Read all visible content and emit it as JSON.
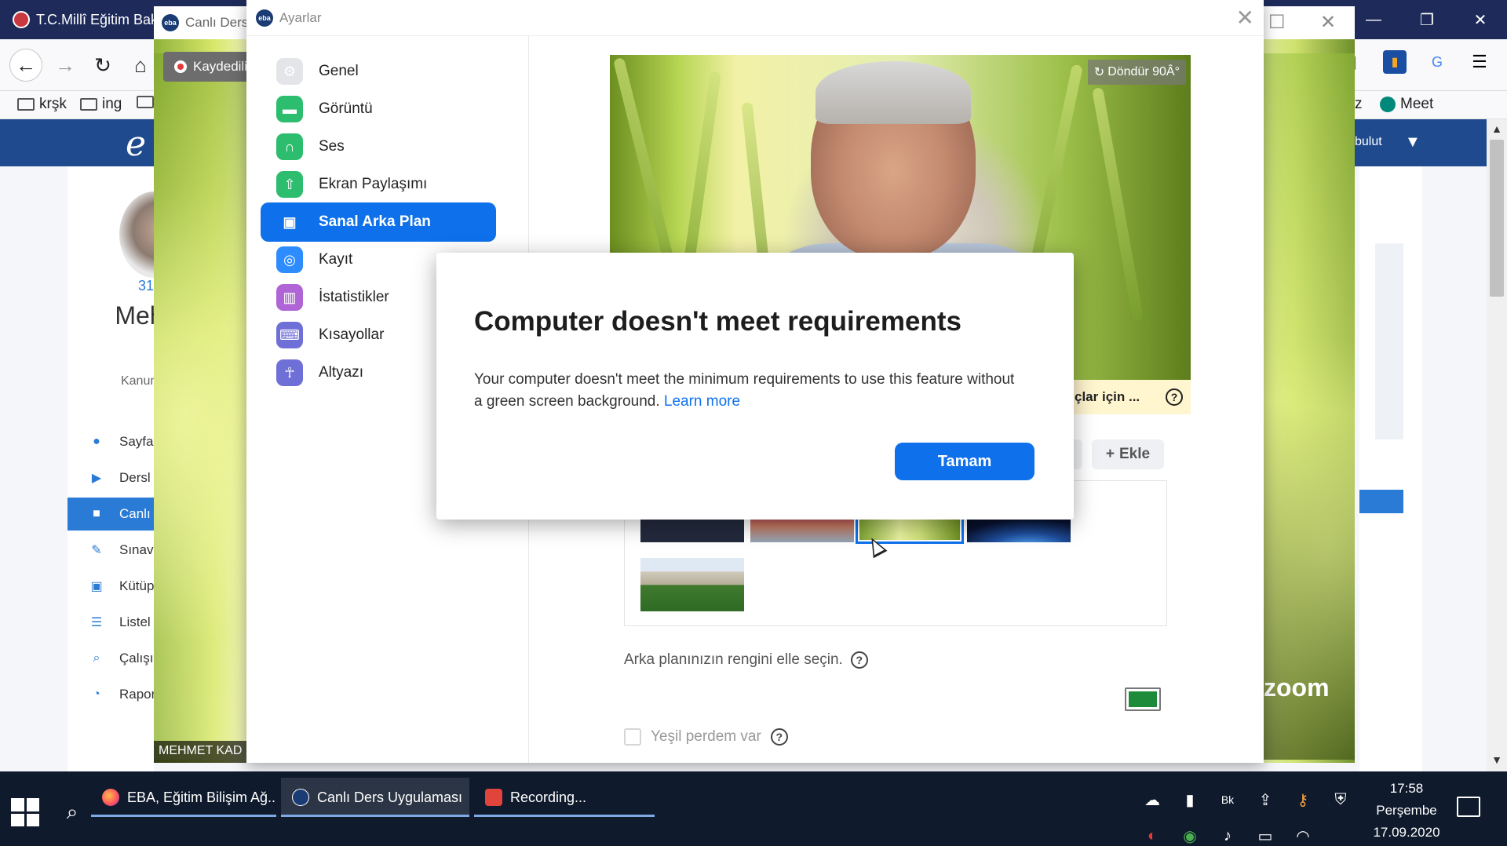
{
  "browser": {
    "tab_title": "T.C.Millî Eğitim Bak",
    "bookmarks": [
      "krşk",
      "ing"
    ],
    "bookmark_meet": "Meet",
    "bookmark_partial": "z",
    "eba_logo": "e",
    "eba_bulut": "bulut"
  },
  "eba": {
    "profile_number": "31",
    "profile_name": "Mehm Ak",
    "profile_school": "Kanuni Su Or",
    "menu": [
      {
        "label": "Sayfa",
        "icon": "user-icon"
      },
      {
        "label": "Dersl",
        "icon": "play-icon"
      },
      {
        "label": "Canlı",
        "icon": "video-camera-icon",
        "active": true
      },
      {
        "label": "Sınav",
        "icon": "pencil-icon"
      },
      {
        "label": "Kütüp",
        "icon": "book-icon"
      },
      {
        "label": "Listel",
        "icon": "list-icon"
      },
      {
        "label": "Çalışı",
        "icon": "search-list-icon"
      },
      {
        "label": "Rapor",
        "icon": "pie-chart-icon"
      }
    ]
  },
  "zoom": {
    "window_title": "Canlı Ders",
    "recording_label": "Kaydediliyor",
    "name_card": "MEHMET KAD",
    "logo": "zoom"
  },
  "settings": {
    "window_title": "Ayarlar",
    "nav": [
      {
        "label": "Genel",
        "icon": "gear-icon",
        "color": "#9aa0a6"
      },
      {
        "label": "Görüntü",
        "icon": "video-icon",
        "color": "#2dbd6e"
      },
      {
        "label": "Ses",
        "icon": "headphones-icon",
        "color": "#2dbd6e"
      },
      {
        "label": "Ekran Paylaşımı",
        "icon": "share-screen-icon",
        "color": "#2dbd6e"
      },
      {
        "label": "Sanal Arka Plan",
        "icon": "portrait-icon",
        "color": "#0e71eb",
        "active": true
      },
      {
        "label": "Kayıt",
        "icon": "record-icon",
        "color": "#2d8cff"
      },
      {
        "label": "İstatistikler",
        "icon": "stats-icon",
        "color": "#b065d6"
      },
      {
        "label": "Kısayollar",
        "icon": "keyboard-icon",
        "color": "#6f6fd8"
      },
      {
        "label": "Altyazı",
        "icon": "accessibility-icon",
        "color": "#6f6fd8"
      }
    ],
    "rotate_label": "Döndür 90Â°",
    "hint_text": "çlar için ...",
    "add_label": "Ekle",
    "backgrounds": [
      "None",
      "Golden Gate",
      "Grass",
      "Earth",
      "Field"
    ],
    "color_label": "Arka planınızın rengini elle seçin.",
    "swatch_color": "#1e8b3a",
    "green_screen_label": "Yeşil perdem var"
  },
  "dialog": {
    "title": "Computer doesn't meet requirements",
    "body": "Your computer doesn't meet the minimum requirements to use this feature without a green screen background.",
    "link": "Learn more",
    "ok_label": "Tamam"
  },
  "taskbar": {
    "items": [
      {
        "label": "EBA, Eğitim Bilişim Ağ...",
        "icon": "firefox-icon"
      },
      {
        "label": "Canlı Ders Uygulaması",
        "icon": "eba-icon",
        "active": true
      },
      {
        "label": "Recording...",
        "icon": "record-app-icon"
      }
    ],
    "time": "17:58",
    "day": "Perşembe",
    "date": "17.09.2020"
  }
}
